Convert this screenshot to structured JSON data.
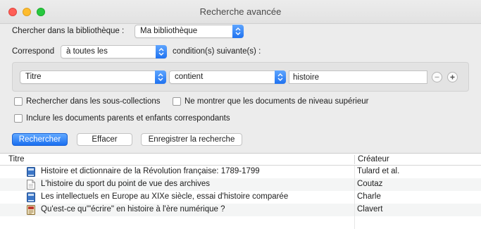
{
  "window": {
    "title": "Recherche avancée"
  },
  "search": {
    "library_label": "Chercher dans la bibliothèque :",
    "library_value": "Ma bibliothèque",
    "match_label": "Correspond",
    "match_value": "à toutes les",
    "match_suffix": "condition(s) suivante(s) :"
  },
  "condition": {
    "field": "Titre",
    "operator": "contient",
    "value": "histoire"
  },
  "options": {
    "subcollections": "Rechercher dans les sous-collections",
    "top_level_only": "Ne montrer que les documents de niveau supérieur",
    "include_parents": "Inclure les documents parents et enfants correspondants"
  },
  "buttons": {
    "search": "Rechercher",
    "clear": "Effacer",
    "save": "Enregistrer la recherche"
  },
  "results": {
    "columns": {
      "title": "Titre",
      "creator": "Créateur"
    },
    "rows": [
      {
        "icon": "book-icon",
        "title": "Histoire et dictionnaire de la Révolution française: 1789-1799",
        "creator": "Tulard et al."
      },
      {
        "icon": "document-icon",
        "title": "L'histoire du sport du point de vue des archives",
        "creator": "Coutaz"
      },
      {
        "icon": "book-icon",
        "title": "Les intellectuels en Europe au XIXe siècle, essai d'histoire comparée",
        "creator": "Charle"
      },
      {
        "icon": "book-section-icon",
        "title": "Qu'est-ce qu'\"écrire\" en histoire à l'ère numérique ?",
        "creator": "Clavert"
      }
    ]
  },
  "colors": {
    "accent": "#1a6ff0",
    "book_icon": "#3b76c8"
  }
}
